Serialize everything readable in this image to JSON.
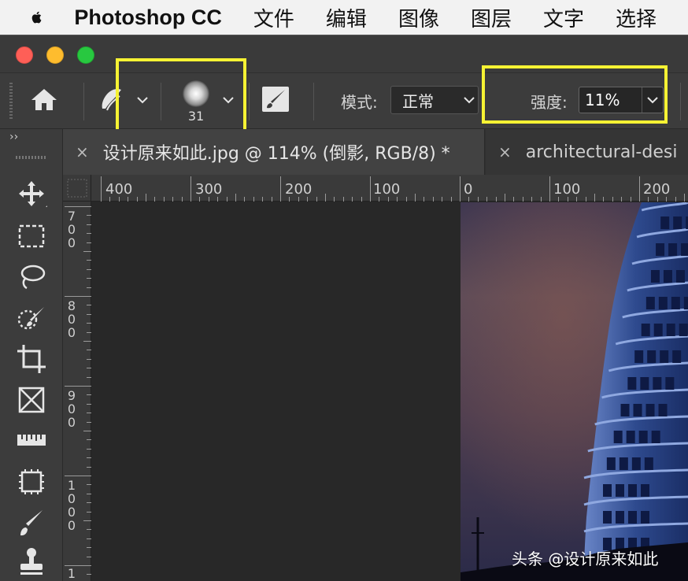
{
  "menubar": {
    "app_name": "Photoshop CC",
    "items": [
      "文件",
      "编辑",
      "图像",
      "图层",
      "文字",
      "选择"
    ]
  },
  "options": {
    "brush_size": "31",
    "mode_label": "模式:",
    "mode_value": "正常",
    "strength_label": "强度:",
    "strength_value": "11%"
  },
  "panel": {
    "collapse": "››"
  },
  "tabs": [
    {
      "title": "设计原来如此.jpg @ 114% (倒影, RGB/8) *",
      "close": "×",
      "active": true
    },
    {
      "title": "architectural-desi",
      "close": "×",
      "active": false
    }
  ],
  "ruler_h": [
    "400",
    "300",
    "200",
    "100",
    "0",
    "100",
    "200"
  ],
  "ruler_v": [
    [
      "7",
      "0",
      "0"
    ],
    [
      "8",
      "0",
      "0"
    ],
    [
      "9",
      "0",
      "0"
    ],
    [
      "1",
      "0",
      "0",
      "0"
    ],
    [
      "1"
    ]
  ],
  "watermark": "头条 @设计原来如此",
  "tools": [
    "move-tool-icon",
    "marquee-tool-icon",
    "lasso-tool-icon",
    "quick-select-tool-icon",
    "crop-tool-icon",
    "frame-tool-icon",
    "ruler-tool-icon",
    "object-select-tool-icon",
    "brush-tool-icon",
    "stamp-tool-icon"
  ],
  "colors": {
    "highlight": "#f6f233",
    "panel": "#3c3c3c",
    "canvas": "#282828"
  }
}
